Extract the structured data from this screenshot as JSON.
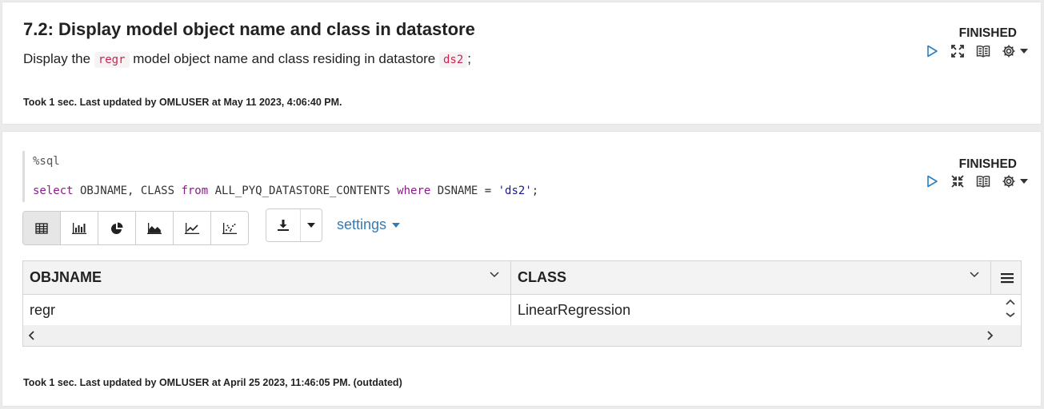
{
  "paragraph1": {
    "title": "7.2: Display model object name and class in datastore",
    "desc_prefix": "Display the ",
    "desc_code1": "regr",
    "desc_middle": " model object name and class residing in datastore ",
    "desc_code2": "ds2",
    "desc_suffix": ";",
    "status": "FINISHED",
    "meta": "Took 1 sec. Last updated by OMLUSER at May 11 2023, 4:06:40 PM."
  },
  "paragraph2": {
    "code_line1": "%sql",
    "code_line2": {
      "kw_select": "select",
      "part1": " OBJNAME, CLASS ",
      "kw_from": "from",
      "part2": " ALL_PYQ_DATASTORE_CONTENTS ",
      "kw_where": "where",
      "part3": " DSNAME = ",
      "string": "'ds2'",
      "end": ";"
    },
    "status": "FINISHED",
    "settings_label": "settings",
    "table": {
      "columns": [
        "OBJNAME",
        "CLASS"
      ],
      "rows": [
        [
          "regr",
          "LinearRegression"
        ]
      ]
    },
    "meta": "Took 1 sec. Last updated by OMLUSER at April 25 2023, 11:46:05 PM. (outdated)"
  },
  "icons": {
    "run": "run-icon",
    "expand": "expand-icon",
    "collapse": "collapse-icon",
    "book": "book-icon",
    "gear": "gear-icon",
    "table": "table-icon",
    "bar": "bar-chart-icon",
    "pie": "pie-chart-icon",
    "area": "area-chart-icon",
    "line": "line-chart-icon",
    "scatter": "scatter-chart-icon",
    "download": "download-icon",
    "menu": "menu-icon"
  },
  "colors": {
    "link": "#337ab7",
    "run": "#2a7fc2",
    "inline_code": "#c7254e",
    "keyword": "#8b1a8b",
    "string": "#1a1a8b"
  }
}
